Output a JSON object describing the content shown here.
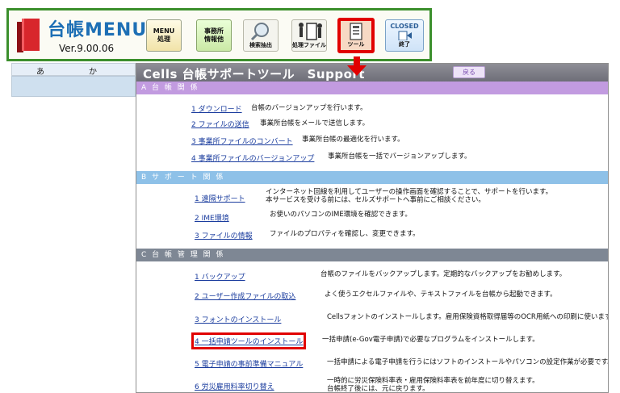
{
  "menu": {
    "title": "台帳MENU",
    "version": "Ver.9.00.06",
    "buttons": {
      "menu_process": "MENU\n処理",
      "office_info": "事務所\n情報他",
      "search": "検索抽出",
      "process_file": "処理ファイル",
      "tools": "ツール",
      "closed_top": "CLOSED",
      "closed_bottom": "終了"
    }
  },
  "sheet": {
    "col_a": "あ",
    "col_ka": "か"
  },
  "panel": {
    "title": "Cells 台帳サポートツール　Support",
    "back": "戻る",
    "sections": [
      {
        "header": "A 台 帳 関 係",
        "items": [
          {
            "link": "1 ダウンロード",
            "desc": "台帳のバージョンアップを行います。"
          },
          {
            "link": "2 ファイルの送信",
            "desc": "事業所台帳をメールで送信します。"
          },
          {
            "link": "3 事業所ファイルのコンバート",
            "desc": "事業所台帳の最適化を行います。"
          },
          {
            "link": "4 事業所ファイルのバージョンアップ",
            "desc": "事業所台帳を一括でバージョンアップします。"
          }
        ]
      },
      {
        "header": "B サ ポ ー ト 関 係",
        "items": [
          {
            "link": "1 遠隔サポート",
            "desc": "インターネット回線を利用してユーザーの操作画面を確認することで、サポートを行います。",
            "desc2": "本サービスを受ける前には、セルズサポートへ事前にご相談ください。"
          },
          {
            "link": "2 IME環境",
            "desc": "お使いのパソコンのIME環境を確認できます。"
          },
          {
            "link": "3 ファイルの情報",
            "desc": "ファイルのプロパティを確認し、変更できます。"
          }
        ]
      },
      {
        "header": "C 台 帳 管 理 関 係",
        "items": [
          {
            "link": "1 バックアップ",
            "desc": "台帳のファイルをバックアップします。定期的なバックアップをお勧めします。"
          },
          {
            "link": "2 ユーザー作成ファイルの取込",
            "desc": "よく使うエクセルファイルや、テキストファイルを台帳から起動できます。"
          },
          {
            "link": "3 フォントのインストール",
            "desc": "Cellsフォントのインストールします。雇用保険資格取得届等のOCR用紙への印刷に使います。"
          },
          {
            "link": "4 一括申請ツールのインストール",
            "desc": "一括申請(e-Gov電子申請)で必要なプログラムをインストールします。"
          },
          {
            "link": "5 電子申請の事前準備マニュアル",
            "desc": "一括申請による電子申請を行うにはソフトのインストールやパソコンの設定作業が必要です。"
          },
          {
            "link": "6 労災雇用料率切り替え",
            "desc": "一時的に労災保険料率表・雇用保険料率表を前年度に切り替えます。",
            "desc2": "台帳終了後には、元に戻ります。"
          }
        ]
      }
    ]
  },
  "colors": {
    "highlight": "#e10000",
    "menu_border": "#3b8f2c",
    "logo": "#1d6fb5"
  }
}
